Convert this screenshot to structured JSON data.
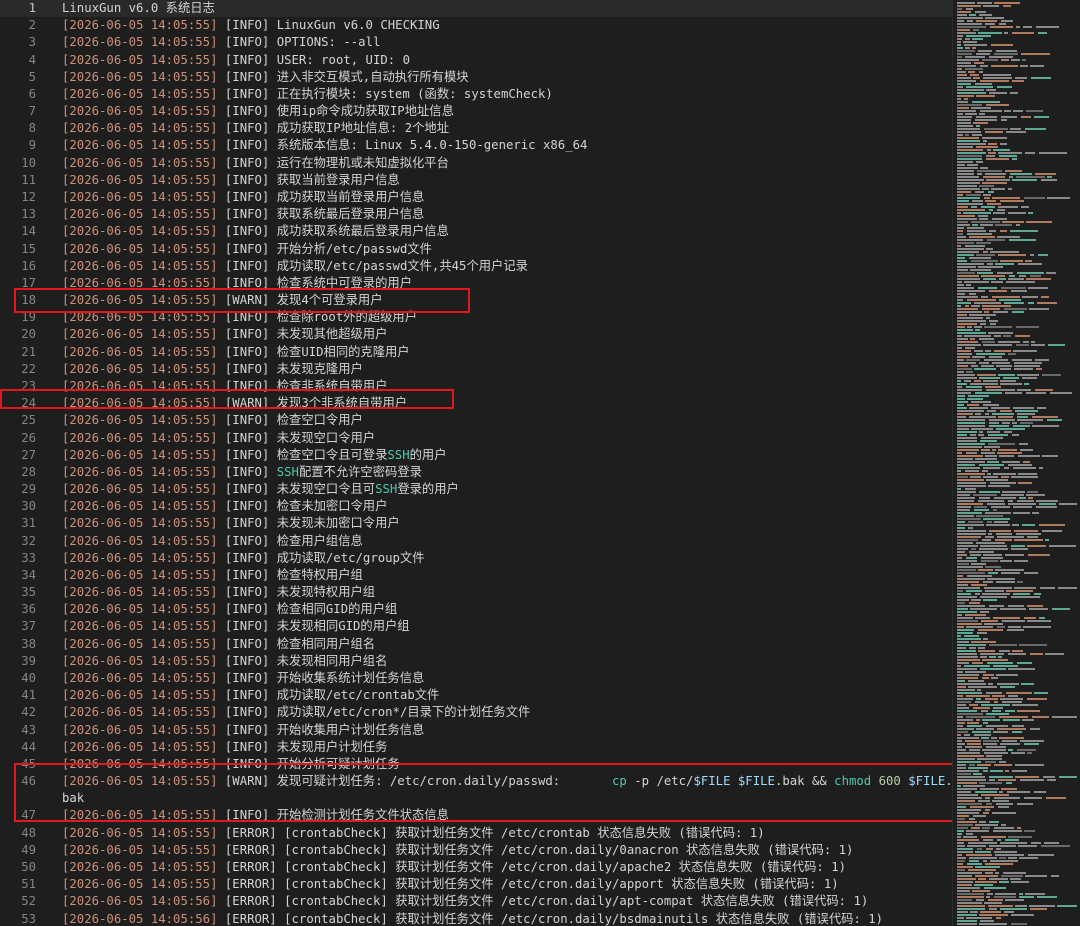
{
  "lines": [
    {
      "n": "1",
      "text": "LinuxGun v6.0 系统日志"
    },
    {
      "n": "2",
      "ts": "[2026-06-05 14:05:55]",
      "lvl": "[INFO]",
      "msg": "LinuxGun v6.0 CHECKING"
    },
    {
      "n": "3",
      "ts": "[2026-06-05 14:05:55]",
      "lvl": "[INFO]",
      "msg": "OPTIONS: --all"
    },
    {
      "n": "4",
      "ts": "[2026-06-05 14:05:55]",
      "lvl": "[INFO]",
      "msg": "USER: root, UID: 0"
    },
    {
      "n": "5",
      "ts": "[2026-06-05 14:05:55]",
      "lvl": "[INFO]",
      "msg": "进入非交互模式,自动执行所有模块"
    },
    {
      "n": "6",
      "ts": "[2026-06-05 14:05:55]",
      "lvl": "[INFO]",
      "msg": "正在执行模块: system (函数: systemCheck)"
    },
    {
      "n": "7",
      "ts": "[2026-06-05 14:05:55]",
      "lvl": "[INFO]",
      "msg": "使用ip命令成功获取IP地址信息"
    },
    {
      "n": "8",
      "ts": "[2026-06-05 14:05:55]",
      "lvl": "[INFO]",
      "msg": "成功获取IP地址信息: 2个地址"
    },
    {
      "n": "9",
      "ts": "[2026-06-05 14:05:55]",
      "lvl": "[INFO]",
      "msg": "系统版本信息: Linux 5.4.0-150-generic x86_64"
    },
    {
      "n": "10",
      "ts": "[2026-06-05 14:05:55]",
      "lvl": "[INFO]",
      "msg": "运行在物理机或未知虚拟化平台"
    },
    {
      "n": "11",
      "ts": "[2026-06-05 14:05:55]",
      "lvl": "[INFO]",
      "msg": "获取当前登录用户信息"
    },
    {
      "n": "12",
      "ts": "[2026-06-05 14:05:55]",
      "lvl": "[INFO]",
      "msg": "成功获取当前登录用户信息"
    },
    {
      "n": "13",
      "ts": "[2026-06-05 14:05:55]",
      "lvl": "[INFO]",
      "msg": "获取系统最后登录用户信息"
    },
    {
      "n": "14",
      "ts": "[2026-06-05 14:05:55]",
      "lvl": "[INFO]",
      "msg": "成功获取系统最后登录用户信息"
    },
    {
      "n": "15",
      "ts": "[2026-06-05 14:05:55]",
      "lvl": "[INFO]",
      "msg": "开始分析/etc/passwd文件"
    },
    {
      "n": "16",
      "ts": "[2026-06-05 14:05:55]",
      "lvl": "[INFO]",
      "msg": "成功读取/etc/passwd文件,共45个用户记录"
    },
    {
      "n": "17",
      "ts": "[2026-06-05 14:05:55]",
      "lvl": "[INFO]",
      "msg": "检查系统中可登录的用户"
    },
    {
      "n": "18",
      "ts": "[2026-06-05 14:05:55]",
      "lvl": "[WARN]",
      "msg": "发现4个可登录用户"
    },
    {
      "n": "19",
      "ts": "[2026-06-05 14:05:55]",
      "lvl": "[INFO]",
      "msg": "检查除root外的超级用户"
    },
    {
      "n": "20",
      "ts": "[2026-06-05 14:05:55]",
      "lvl": "[INFO]",
      "msg": "未发现其他超级用户"
    },
    {
      "n": "21",
      "ts": "[2026-06-05 14:05:55]",
      "lvl": "[INFO]",
      "msg": "检查UID相同的克隆用户"
    },
    {
      "n": "22",
      "ts": "[2026-06-05 14:05:55]",
      "lvl": "[INFO]",
      "msg": "未发现克隆用户"
    },
    {
      "n": "23",
      "ts": "[2026-06-05 14:05:55]",
      "lvl": "[INFO]",
      "msg": "检查非系统自带用户"
    },
    {
      "n": "24",
      "ts": "[2026-06-05 14:05:55]",
      "lvl": "[WARN]",
      "msg": "发现3个非系统自带用户"
    },
    {
      "n": "25",
      "ts": "[2026-06-05 14:05:55]",
      "lvl": "[INFO]",
      "msg": "检查空口令用户"
    },
    {
      "n": "26",
      "ts": "[2026-06-05 14:05:55]",
      "lvl": "[INFO]",
      "msg": "未发现空口令用户"
    },
    {
      "n": "27",
      "ts": "[2026-06-05 14:05:55]",
      "lvl": "[INFO]",
      "msg_pre": "检查空口令且可登录",
      "ssh": "SSH",
      "msg_post": "的用户"
    },
    {
      "n": "28",
      "ts": "[2026-06-05 14:05:55]",
      "lvl": "[INFO]",
      "msg_pre": "",
      "ssh": "SSH",
      "msg_post": "配置不允许空密码登录"
    },
    {
      "n": "29",
      "ts": "[2026-06-05 14:05:55]",
      "lvl": "[INFO]",
      "msg_pre": "未发现空口令且可",
      "ssh": "SSH",
      "msg_post": "登录的用户"
    },
    {
      "n": "30",
      "ts": "[2026-06-05 14:05:55]",
      "lvl": "[INFO]",
      "msg": "检查未加密口令用户"
    },
    {
      "n": "31",
      "ts": "[2026-06-05 14:05:55]",
      "lvl": "[INFO]",
      "msg": "未发现未加密口令用户"
    },
    {
      "n": "32",
      "ts": "[2026-06-05 14:05:55]",
      "lvl": "[INFO]",
      "msg": "检查用户组信息"
    },
    {
      "n": "33",
      "ts": "[2026-06-05 14:05:55]",
      "lvl": "[INFO]",
      "msg": "成功读取/etc/group文件"
    },
    {
      "n": "34",
      "ts": "[2026-06-05 14:05:55]",
      "lvl": "[INFO]",
      "msg": "检查特权用户组"
    },
    {
      "n": "35",
      "ts": "[2026-06-05 14:05:55]",
      "lvl": "[INFO]",
      "msg": "未发现特权用户组"
    },
    {
      "n": "36",
      "ts": "[2026-06-05 14:05:55]",
      "lvl": "[INFO]",
      "msg": "检查相同GID的用户组"
    },
    {
      "n": "37",
      "ts": "[2026-06-05 14:05:55]",
      "lvl": "[INFO]",
      "msg": "未发现相同GID的用户组"
    },
    {
      "n": "38",
      "ts": "[2026-06-05 14:05:55]",
      "lvl": "[INFO]",
      "msg": "检查相同用户组名"
    },
    {
      "n": "39",
      "ts": "[2026-06-05 14:05:55]",
      "lvl": "[INFO]",
      "msg": "未发现相同用户组名"
    },
    {
      "n": "40",
      "ts": "[2026-06-05 14:05:55]",
      "lvl": "[INFO]",
      "msg": "开始收集系统计划任务信息"
    },
    {
      "n": "41",
      "ts": "[2026-06-05 14:05:55]",
      "lvl": "[INFO]",
      "msg": "成功读取/etc/crontab文件"
    },
    {
      "n": "42",
      "ts": "[2026-06-05 14:05:55]",
      "lvl": "[INFO]",
      "msg": "成功读取/etc/cron*/目录下的计划任务文件"
    },
    {
      "n": "43",
      "ts": "[2026-06-05 14:05:55]",
      "lvl": "[INFO]",
      "msg": "开始收集用户计划任务信息"
    },
    {
      "n": "44",
      "ts": "[2026-06-05 14:05:55]",
      "lvl": "[INFO]",
      "msg": "未发现用户计划任务"
    },
    {
      "n": "45",
      "ts": "[2026-06-05 14:05:55]",
      "lvl": "[INFO]",
      "msg": "开始分析可疑计划任务"
    },
    {
      "n": "46",
      "ts": "[2026-06-05 14:05:55]",
      "lvl": "[WARN]",
      "msg": "发现可疑计划任务: /etc/cron.daily/passwd:       ",
      "cmd1": "cp",
      "cmd2": " -p /etc/",
      "var1": "$FILE",
      "cmd3": " ",
      "var2": "$FILE",
      "cmd4": ".bak && ",
      "cmd5": "chmod",
      "cmd6": " ",
      "num": "600",
      "cmd7": " ",
      "var3": "$FILE",
      "cmd8": ".",
      "wrap": "bak"
    },
    {
      "n": "47",
      "ts": "[2026-06-05 14:05:55]",
      "lvl": "[INFO]",
      "msg": "开始检测计划任务文件状态信息"
    },
    {
      "n": "48",
      "ts": "[2026-06-05 14:05:55]",
      "lvl": "[ERROR]",
      "tag": "[crontabCheck]",
      "msg": "获取计划任务文件 /etc/crontab 状态信息失败 (错误代码: 1)"
    },
    {
      "n": "49",
      "ts": "[2026-06-05 14:05:55]",
      "lvl": "[ERROR]",
      "tag": "[crontabCheck]",
      "msg": "获取计划任务文件 /etc/cron.daily/0anacron 状态信息失败 (错误代码: 1)"
    },
    {
      "n": "50",
      "ts": "[2026-06-05 14:05:55]",
      "lvl": "[ERROR]",
      "tag": "[crontabCheck]",
      "msg": "获取计划任务文件 /etc/cron.daily/apache2 状态信息失败 (错误代码: 1)"
    },
    {
      "n": "51",
      "ts": "[2026-06-05 14:05:55]",
      "lvl": "[ERROR]",
      "tag": "[crontabCheck]",
      "msg": "获取计划任务文件 /etc/cron.daily/apport 状态信息失败 (错误代码: 1)"
    },
    {
      "n": "52",
      "ts": "[2026-06-05 14:05:56]",
      "lvl": "[ERROR]",
      "tag": "[crontabCheck]",
      "msg": "获取计划任务文件 /etc/cron.daily/apt-compat 状态信息失败 (错误代码: 1)"
    },
    {
      "n": "53",
      "ts": "[2026-06-05 14:05:56]",
      "lvl": "[ERROR]",
      "tag": "[crontabCheck]",
      "msg": "获取计划任务文件 /etc/cron.daily/bsdmainutils 状态信息失败 (错误代码: 1)"
    }
  ]
}
